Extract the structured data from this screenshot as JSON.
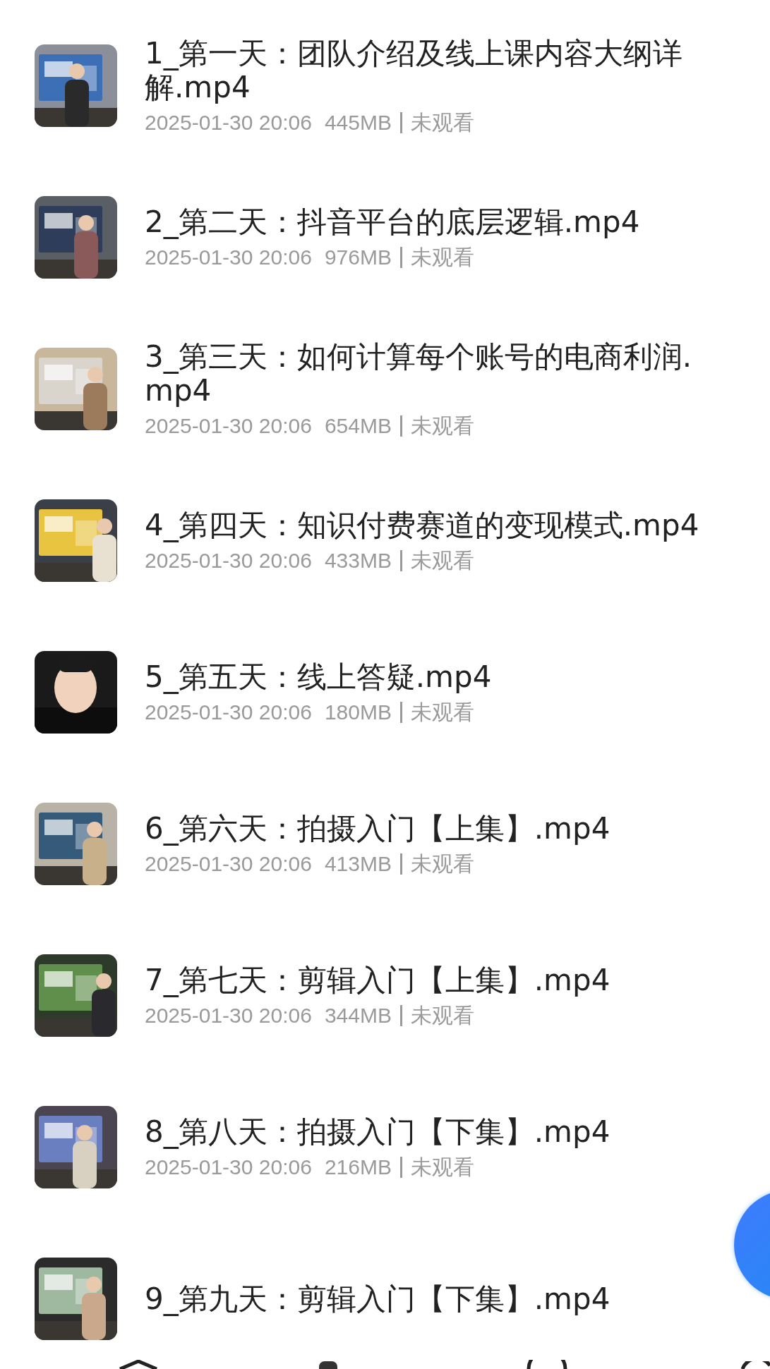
{
  "videos": [
    {
      "title": "1_第一天：团队介绍及线上课内容大纲详解.mp4",
      "date": "2025-01-30 20:06",
      "size": "445MB",
      "status": "未观看"
    },
    {
      "title": "2_第二天：抖音平台的底层逻辑.mp4",
      "date": "2025-01-30 20:06",
      "size": "976MB",
      "status": "未观看"
    },
    {
      "title": "3_第三天：如何计算每个账号的电商利润.mp4",
      "date": "2025-01-30 20:06",
      "size": "654MB",
      "status": "未观看"
    },
    {
      "title": "4_第四天：知识付费赛道的变现模式.mp4",
      "date": "2025-01-30 20:06",
      "size": "433MB",
      "status": "未观看"
    },
    {
      "title": "5_第五天：线上答疑.mp4",
      "date": "2025-01-30 20:06",
      "size": "180MB",
      "status": "未观看"
    },
    {
      "title": "6_第六天：拍摄入门【上集】.mp4",
      "date": "2025-01-30 20:06",
      "size": "413MB",
      "status": "未观看"
    },
    {
      "title": "7_第七天：剪辑入门【上集】.mp4",
      "date": "2025-01-30 20:06",
      "size": "344MB",
      "status": "未观看"
    },
    {
      "title": "8_第八天：拍摄入门【下集】.mp4",
      "date": "2025-01-30 20:06",
      "size": "216MB",
      "status": "未观看"
    },
    {
      "title": "9_第九天：剪辑入门【下集】.mp4"
    }
  ]
}
